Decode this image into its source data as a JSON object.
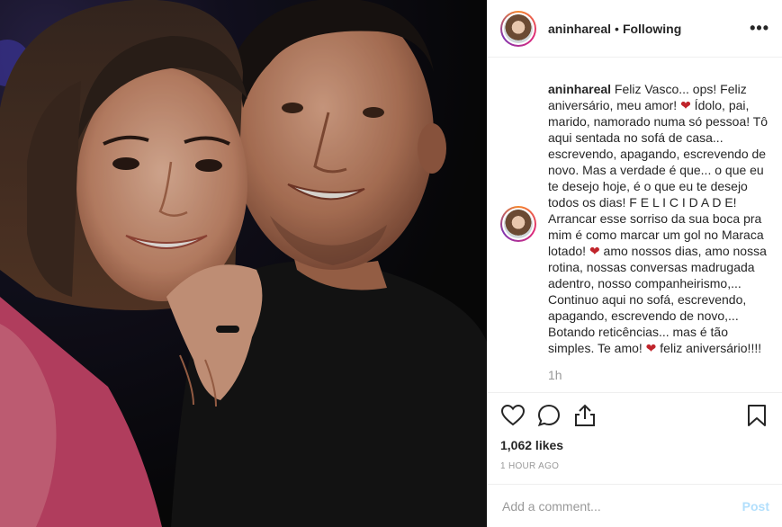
{
  "header": {
    "username": "aninhareal",
    "separator": "•",
    "follow_status": "Following",
    "more_label": "•••"
  },
  "caption": {
    "username": "aninhareal",
    "part1": "Feliz Vasco... ops! Feliz aniversário, meu amor! ",
    "heart": "❤",
    "part2": " Ídolo, pai, marido, namorado numa só pessoa! Tô aqui sentada no sofá de casa... escrevendo, apagando, escrevendo de novo. Mas a verdade é que... o que eu te desejo hoje, é o que eu te desejo todos os dias! F E L I C I D A D E! Arrancar esse sorriso da sua boca pra mim é como marcar um gol no Maraca lotado! ",
    "part3": " amo nossos dias, amo nossa rotina, nossas conversas madrugada adentro, nosso companheirismo,... Continuo aqui no sofá, escrevendo, apagando, escrevendo de novo,... Botando reticências... mas é tão simples. Te amo! ",
    "part4": " feliz aniversário!!!!",
    "time": "1h"
  },
  "actions": {
    "like_icon": "heart-outline-icon",
    "comment_icon": "comment-bubble-icon",
    "share_icon": "share-arrow-icon",
    "save_icon": "bookmark-icon"
  },
  "likes": "1,062 likes",
  "posted_ago": "1 HOUR AGO",
  "add_comment": {
    "placeholder": "Add a comment...",
    "post_label": "Post"
  },
  "colors": {
    "heart": "#c0242b",
    "post_button": "#b2dffc",
    "muted_text": "#999999"
  }
}
